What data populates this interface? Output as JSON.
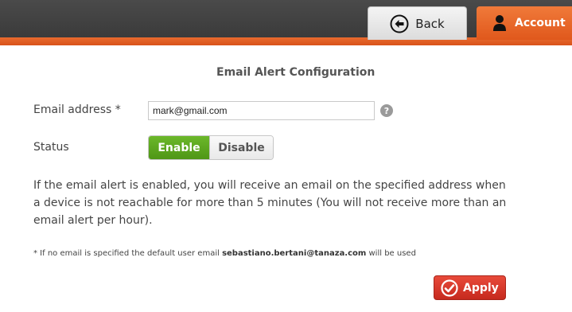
{
  "header": {
    "back_label": "Back",
    "account_label": "Account",
    "accent_color": "#e0581c"
  },
  "page": {
    "title": "Email Alert Configuration"
  },
  "form": {
    "email_label": "Email address *",
    "email_value": "mark@gmail.com",
    "help_glyph": "?",
    "status_label": "Status",
    "enable_label": "Enable",
    "disable_label": "Disable",
    "status_selected": "Enable"
  },
  "description": "If the email alert is enabled, you will receive an email on the specified address when a device is not reachable for more than 5 minutes (You will not receive more than an email alert per hour).",
  "footnote": {
    "prefix": "* If no email is specified the default user email ",
    "email": "sebastiano.bertani@tanaza.com",
    "suffix": " will be used"
  },
  "actions": {
    "apply_label": "Apply",
    "apply_color": "#d0352a"
  },
  "icons": {
    "back": "arrow-left-circle-icon",
    "account": "user-silhouette-icon",
    "help": "question-circle-icon",
    "apply": "check-circle-icon"
  }
}
